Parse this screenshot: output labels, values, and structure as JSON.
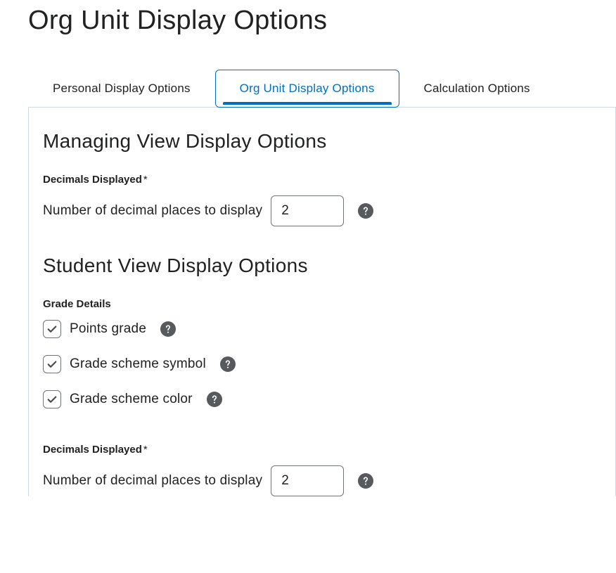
{
  "page": {
    "title": "Org Unit Display Options"
  },
  "tabs": [
    {
      "label": "Personal Display Options",
      "active": false
    },
    {
      "label": "Org Unit Display Options",
      "active": true
    },
    {
      "label": "Calculation Options",
      "active": false
    }
  ],
  "managing_view": {
    "heading": "Managing View Display Options",
    "decimals_field_label": "Decimals Displayed",
    "required_marker": "*",
    "decimals_inline_label": "Number of decimal places to display",
    "decimals_value": "2"
  },
  "student_view": {
    "heading": "Student View Display Options",
    "grade_details_label": "Grade Details",
    "checkboxes": {
      "points_grade": {
        "label": "Points grade",
        "checked": true
      },
      "grade_scheme_symbol": {
        "label": "Grade scheme symbol",
        "checked": true
      },
      "grade_scheme_color": {
        "label": "Grade scheme color",
        "checked": true
      }
    },
    "decimals_field_label": "Decimals Displayed",
    "required_marker": "*",
    "decimals_inline_label": "Number of decimal places to display",
    "decimals_value": "2"
  }
}
